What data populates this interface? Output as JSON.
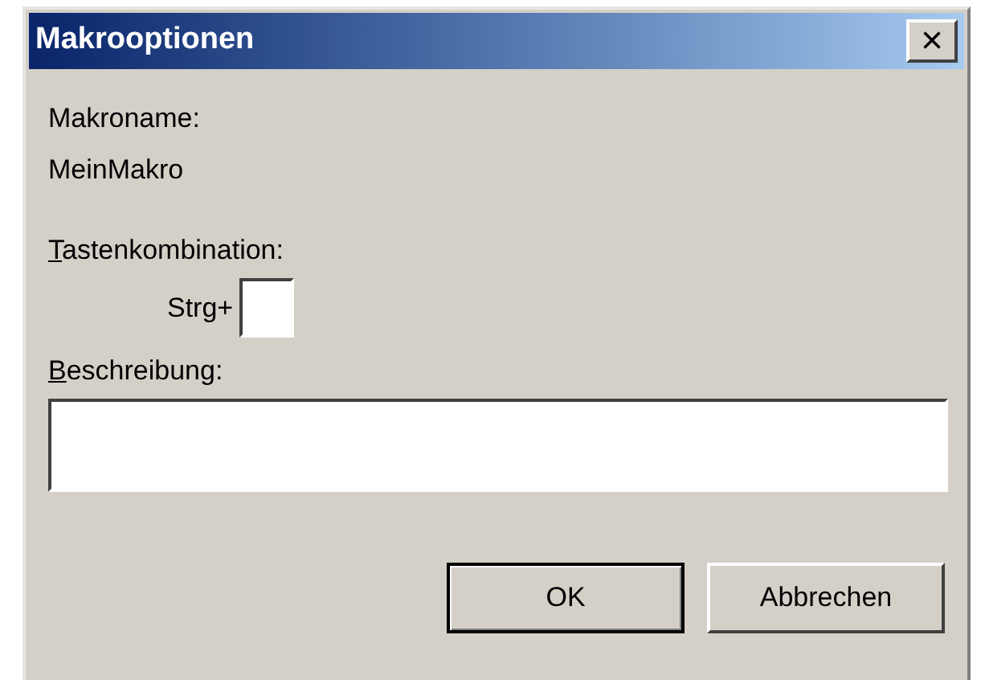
{
  "window": {
    "title": "Makrooptionen",
    "close": "×"
  },
  "macro_name": {
    "label": "Makroname:",
    "value": "MeinMakro"
  },
  "shortcut": {
    "label": "Tastenkombination:",
    "underline_first": true,
    "prefix": "Strg+"
  },
  "description": {
    "label": "Beschreibung:",
    "underline_first": true
  },
  "buttons": [
    {
      "label": "OK",
      "default": true
    },
    {
      "label": "Abbrechen",
      "default": false
    }
  ]
}
